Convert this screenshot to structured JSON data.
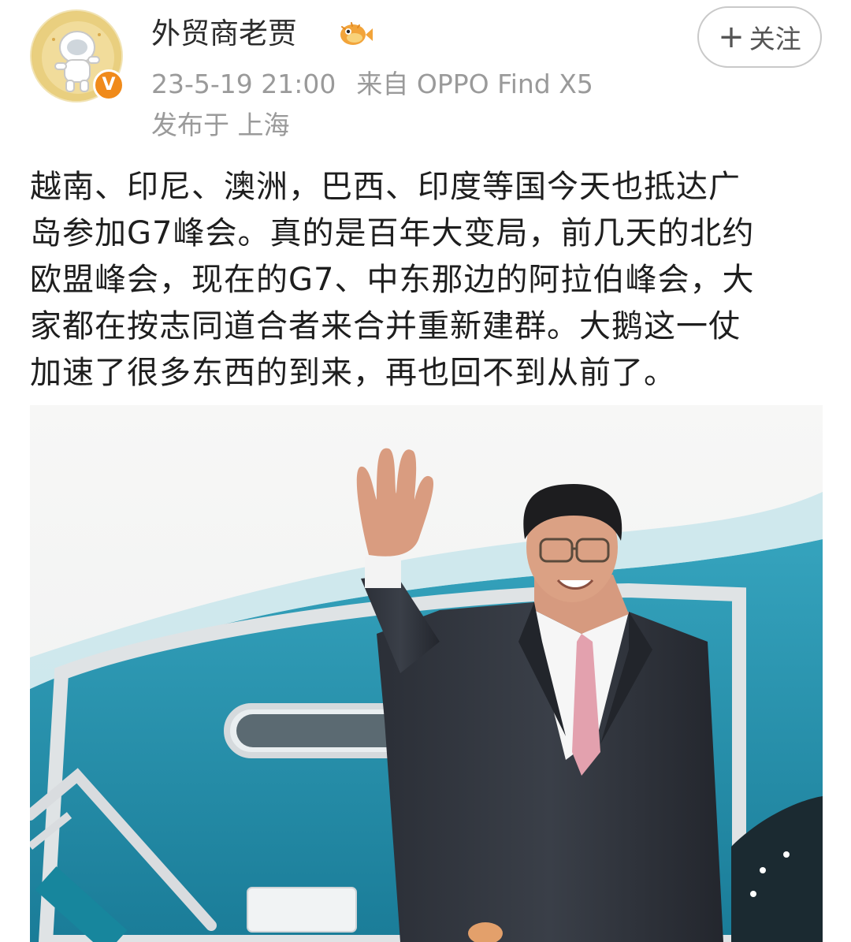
{
  "post": {
    "author_name": "外贸商老贾",
    "verified_badge": "V",
    "timestamp": "23-5-19 21:00",
    "source": "来自 OPPO Find X5",
    "location": "发布于 上海",
    "follow_label": "关注",
    "follow_plus": "+",
    "text_lines": [
      "越南、印尼、澳洲，巴西、印度等国今天也抵达广",
      "岛参加G7峰会。真的是百年大变局，前几天的北约",
      "欧盟峰会，现在的G7、中东那边的阿拉伯峰会，大",
      "家都在按志同道合者来合并重新建群。大鹅这一仗",
      "加速了很多东西的到来，再也回不到从前了。"
    ]
  },
  "icons": {
    "avatar": "avatar-astronaut-icon",
    "badge": "verified-v-icon",
    "title_decoration": "pufferfish-icon"
  },
  "colors": {
    "badge_orange": "#f08a1a",
    "meta_gray": "#9a9a9a",
    "aircraft_teal": "#1f8aa6"
  }
}
